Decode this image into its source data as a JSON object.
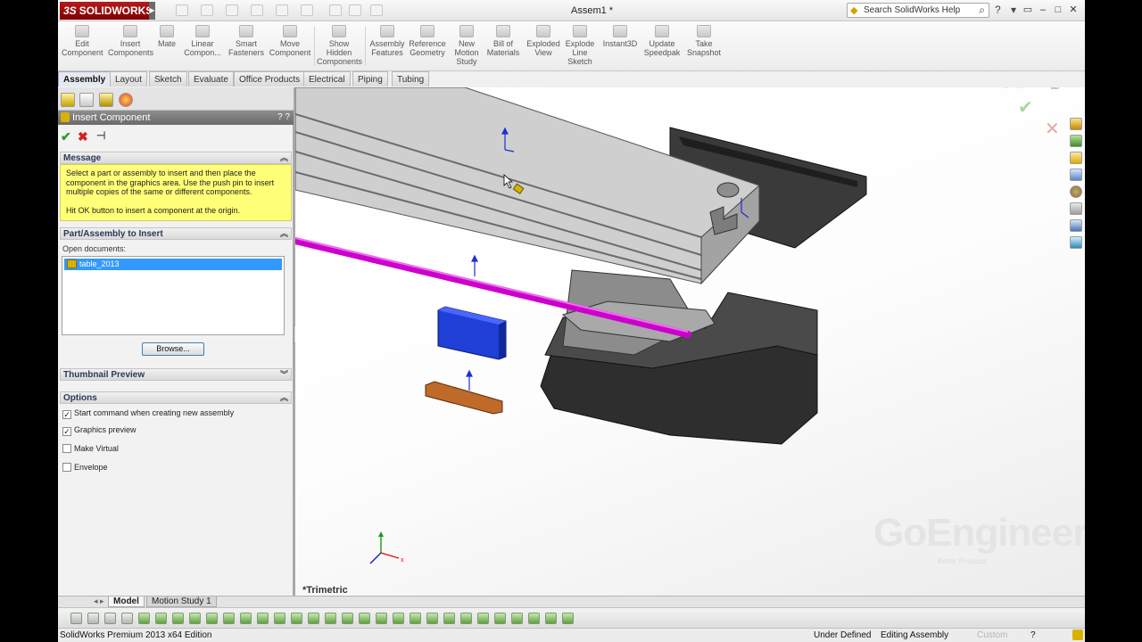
{
  "title_bar": {
    "logo": "SOLIDWORKS",
    "logo_mark": "3S",
    "document_title": "Assem1 *",
    "search_placeholder": "Search SolidWorks Help"
  },
  "ribbon": {
    "buttons": [
      {
        "label": "Edit\nComponent"
      },
      {
        "label": "Insert\nComponents"
      },
      {
        "label": "Mate"
      },
      {
        "label": "Linear\nCompon..."
      },
      {
        "label": "Smart\nFasteners"
      },
      {
        "label": "Move\nComponent"
      },
      {
        "label": "Show\nHidden\nComponents"
      },
      {
        "label": "Assembly\nFeatures"
      },
      {
        "label": "Reference\nGeometry"
      },
      {
        "label": "New\nMotion\nStudy"
      },
      {
        "label": "Bill of\nMaterials"
      },
      {
        "label": "Exploded\nView"
      },
      {
        "label": "Explode\nLine\nSketch"
      },
      {
        "label": "Instant3D"
      },
      {
        "label": "Update\nSpeedpak"
      },
      {
        "label": "Take\nSnapshot"
      }
    ]
  },
  "command_tabs": [
    "Assembly",
    "Layout",
    "Sketch",
    "Evaluate",
    "Office Products",
    "Electrical",
    "Piping",
    "Tubing"
  ],
  "property_manager": {
    "title": "Insert Component",
    "help_marks": "?  ?",
    "message_header": "Message",
    "message_lines": [
      "Select a part or assembly to insert and then place the",
      "component in the graphics area. Use the push pin to insert",
      "multiple copies of the same or different components."
    ],
    "message_ok": "Hit OK button to insert a component at the origin.",
    "part_header": "Part/Assembly to Insert",
    "open_documents_label": "Open documents:",
    "open_documents": [
      "table_2013"
    ],
    "browse_label": "Browse...",
    "thumbnail_header": "Thumbnail Preview",
    "options_header": "Options",
    "options": [
      {
        "label": "Start command when creating new assembly",
        "checked": true
      },
      {
        "label": "Graphics preview",
        "checked": true
      },
      {
        "label": "Make Virtual",
        "checked": false
      },
      {
        "label": "Envelope",
        "checked": false
      }
    ]
  },
  "graphics": {
    "view_name": "*Trimetric",
    "watermark": "GoEngineer",
    "watermark_sub": "Better Products"
  },
  "bottom_tabs": [
    "Model",
    "Motion Study 1"
  ],
  "status_bar": {
    "product": "SolidWorks Premium 2013 x64 Edition",
    "state": "Under Defined",
    "mode": "Editing Assembly",
    "custom": "Custom",
    "help": "?"
  },
  "colors": {
    "brand_red": "#b71c1c",
    "message_yellow": "#ffff78",
    "selection_blue": "#3399ff",
    "rod_magenta": "#cc00cc",
    "block_blue": "#1f3fd6",
    "plate_orange": "#c06a2a"
  }
}
